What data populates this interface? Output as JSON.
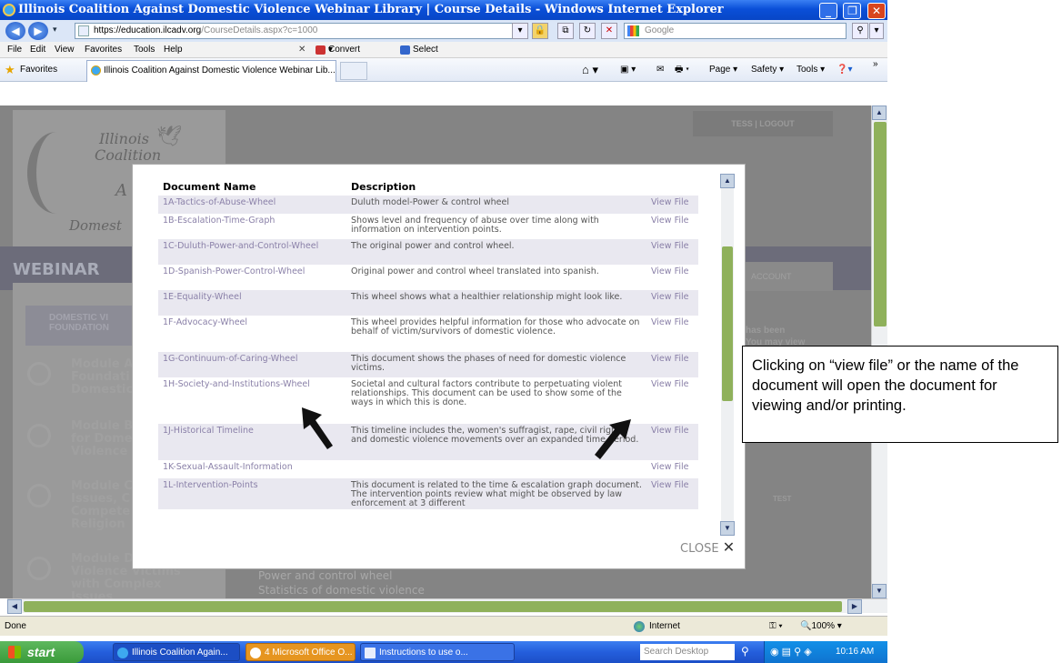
{
  "window": {
    "title": "Illinois Coalition Against Domestic Violence Webinar Library | Course Details - Windows Internet Explorer",
    "controls": [
      "_",
      "❐",
      "✕"
    ]
  },
  "address_bar": {
    "url_prefix": "https://",
    "url_host": "education.ilcadv.org",
    "url_path": "/CourseDetails.aspx?c=1000",
    "search_placeholder": "Google"
  },
  "menu": {
    "items": [
      "File",
      "Edit",
      "View",
      "Favorites",
      "Tools",
      "Help"
    ],
    "convert_label": "Convert",
    "select_label": "Select"
  },
  "favorites_bar": {
    "favorites_label": "Favorites",
    "tab_label": "Illinois Coalition Against Domestic Violence Webinar Lib...",
    "page_menu": "Page",
    "safety_menu": "Safety",
    "tools_menu": "Tools"
  },
  "page": {
    "account_link": "TESS | LOGOUT",
    "logo_line1": "Illinois",
    "logo_line2": "Coalition",
    "logo_line3": "A",
    "logo_line4": "Domest",
    "webinar_heading": "WEBINAR",
    "account_tab": "ACCOUNT",
    "domestic_label_1": "DOMESTIC VI",
    "domestic_label_2": "FOUNDATION",
    "note_1": "has been",
    "note_2": "You may view",
    "test_label": "TEST",
    "modules": [
      {
        "line1": "Module A",
        "line2": "Foundati",
        "line3": "Domestic"
      },
      {
        "line1": "Module B",
        "line2": "for Dome",
        "line3": "Violence"
      },
      {
        "line1": "Module C",
        "line2": "Issues, C",
        "line3": "Compete",
        "line4": "Religion"
      },
      {
        "line1": "Module D",
        "line2": "Violence Victims",
        "line3": "with Complex",
        "line4": "Issues"
      }
    ],
    "bottom_line1": "Power and control wheel",
    "bottom_line2": "Statistics of domestic violence"
  },
  "modal": {
    "headers": {
      "name": "Document Name",
      "description": "Description"
    },
    "view_label": "View File",
    "close_label": "CLOSE",
    "rows": [
      {
        "name": "1A-Tactics-of-Abuse-Wheel",
        "description": "Duluth model-Power & control wheel"
      },
      {
        "name": "1B-Escalation-Time-Graph",
        "description": "Shows level and frequency of abuse over time along with information on intervention points."
      },
      {
        "name": "1C-Duluth-Power-and-Control-Wheel",
        "description": "The original power and control wheel."
      },
      {
        "name": "1D-Spanish-Power-Control-Wheel",
        "description": "Original power and control wheel translated into spanish."
      },
      {
        "name": "1E-Equality-Wheel",
        "description": "This wheel shows what a healthier relationship might look like."
      },
      {
        "name": "1F-Advocacy-Wheel",
        "description": "This wheel provides helpful information for those who advocate on behalf of victim/survivors of domestic violence."
      },
      {
        "name": "1G-Continuum-of-Caring-Wheel",
        "description": "This document shows the phases of need for domestic violence victims."
      },
      {
        "name": "1H-Society-and-Institutions-Wheel",
        "description": "Societal and cultural factors contribute to perpetuating violent relationships. This document can be used to show some of the ways in which this is done."
      },
      {
        "name": "1J-Historical Timeline",
        "description": "This timeline includes the, women's suffragist, rape, civil rights and domestic violence movements over an expanded time period."
      },
      {
        "name": "1K-Sexual-Assault-Information",
        "description": ""
      },
      {
        "name": "1L-Intervention-Points",
        "description": "This document is related to the time & escalation graph document. The intervention points review what might be observed by law enforcement at 3 different"
      }
    ]
  },
  "callout": {
    "text": "Clicking on “view file” or the name of the document will open the document for viewing and/or printing."
  },
  "status_bar": {
    "status": "Done",
    "zone": "Internet",
    "zoom": "100%"
  },
  "taskbar": {
    "start_label": "start",
    "tasks": [
      "Illinois Coalition Again...",
      "4 Microsoft Office O...",
      "Instructions to use o..."
    ],
    "search_placeholder": "Search Desktop",
    "clock": "10:16 AM"
  },
  "colors": {
    "link_purple": "#8a80a8",
    "row_alt": "#e9e8f0",
    "scroll_thumb": "#8fb15b",
    "xp_blue": "#245edc"
  }
}
